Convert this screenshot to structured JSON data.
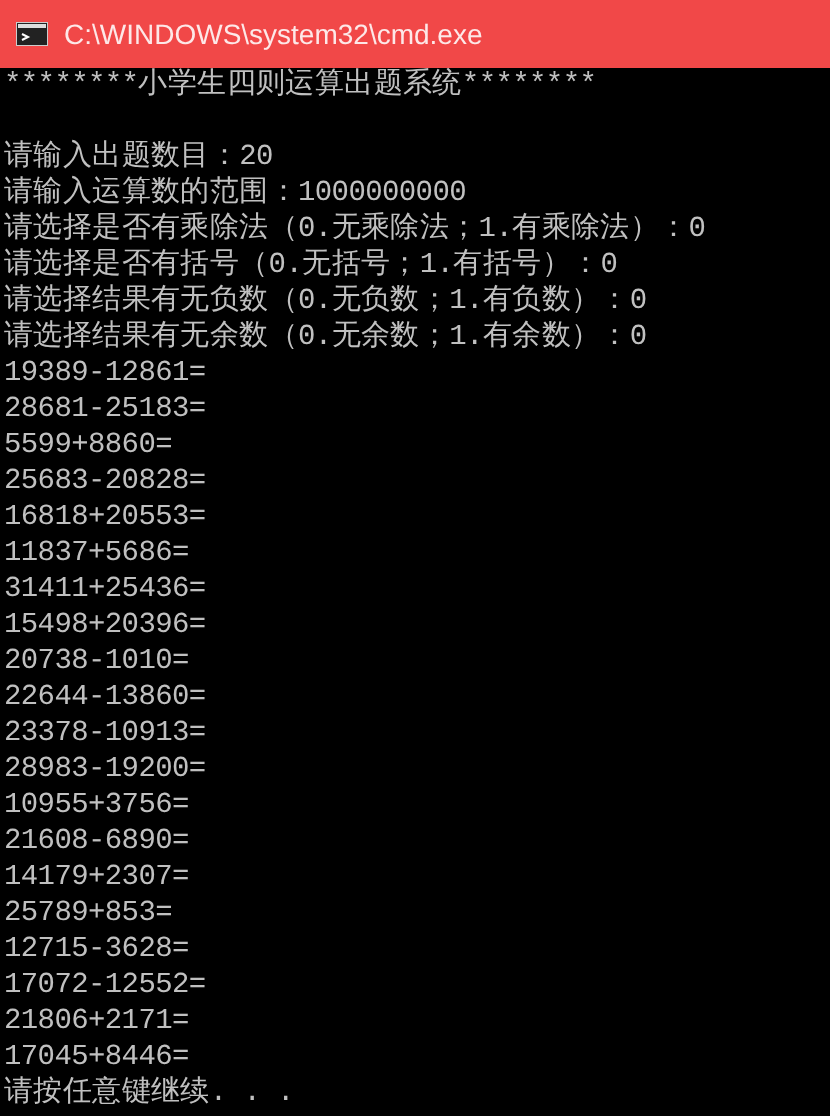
{
  "window": {
    "title": "C:\\WINDOWS\\system32\\cmd.exe"
  },
  "banner": "********小学生四则运算出题系统********",
  "prompts": [
    "请输入出题数目：20",
    "请输入运算数的范围：1000000000",
    "请选择是否有乘除法（0.无乘除法；1.有乘除法）：0",
    "请选择是否有括号（0.无括号；1.有括号）：0",
    "请选择结果有无负数（0.无负数；1.有负数）：0",
    "请选择结果有无余数（0.无余数；1.有余数）：0"
  ],
  "problems": [
    "19389-12861=",
    "28681-25183=",
    "5599+8860=",
    "25683-20828=",
    "16818+20553=",
    "11837+5686=",
    "31411+25436=",
    "15498+20396=",
    "20738-1010=",
    "22644-13860=",
    "23378-10913=",
    "28983-19200=",
    "10955+3756=",
    "21608-6890=",
    "14179+2307=",
    "25789+853=",
    "12715-3628=",
    "17072-12552=",
    "21806+2171=",
    "17045+8446="
  ],
  "pause": "请按任意键继续. . ."
}
